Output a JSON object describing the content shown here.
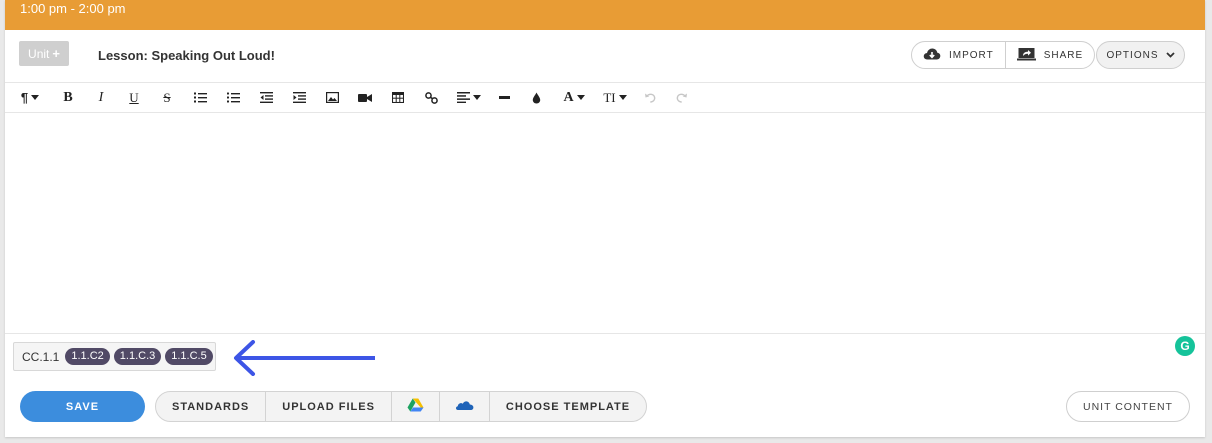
{
  "timebar": {
    "time": "1:00 pm - 2:00 pm",
    "color": "#e89c35"
  },
  "header": {
    "unit_label": "Unit",
    "unit_plus": "+",
    "lesson_title": "Lesson: Speaking Out Loud!",
    "import_label": "IMPORT",
    "share_label": "SHARE",
    "options_label": "OPTIONS"
  },
  "toolbar": {
    "items": [
      {
        "name": "paragraph-format-icon",
        "glyph": "¶"
      },
      {
        "name": "bold-icon",
        "glyph": "B"
      },
      {
        "name": "italic-icon",
        "glyph": "I"
      },
      {
        "name": "underline-icon",
        "glyph": "U"
      },
      {
        "name": "strikethrough-icon",
        "glyph": "S"
      },
      {
        "name": "ordered-list-icon"
      },
      {
        "name": "unordered-list-icon"
      },
      {
        "name": "outdent-icon"
      },
      {
        "name": "indent-icon"
      },
      {
        "name": "image-icon"
      },
      {
        "name": "video-icon"
      },
      {
        "name": "table-icon"
      },
      {
        "name": "link-icon"
      },
      {
        "name": "align-icon"
      },
      {
        "name": "horizontal-rule-icon"
      },
      {
        "name": "color-drop-icon"
      },
      {
        "name": "font-family-icon",
        "glyph": "A"
      },
      {
        "name": "font-size-icon",
        "glyph": "TI"
      },
      {
        "name": "undo-icon"
      },
      {
        "name": "redo-icon"
      }
    ]
  },
  "standards": {
    "code": "CC.1.1",
    "chips": [
      "1.1.C2",
      "1.1.C.3",
      "1.1.C.5"
    ]
  },
  "actions": {
    "save_label": "SAVE",
    "standards_label": "STANDARDS",
    "upload_label": "UPLOAD FILES",
    "template_label": "CHOOSE TEMPLATE",
    "unit_content_label": "UNIT CONTENT"
  },
  "colors": {
    "accent_orange": "#e89c35",
    "save_blue": "#3c8ddd",
    "chip": "#514a66",
    "arrow": "#3d55e6",
    "grammarly": "#15c39a"
  }
}
